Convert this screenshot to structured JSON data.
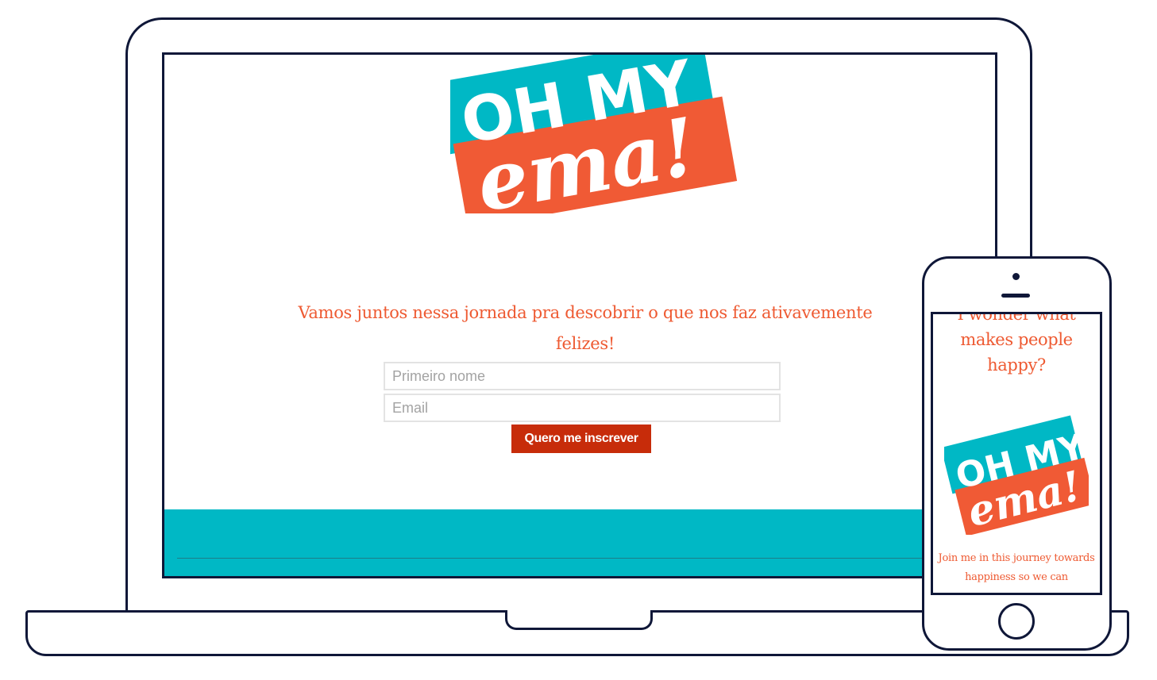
{
  "desktop": {
    "logo": {
      "line1": "OH MY",
      "line2": "ema!"
    },
    "tagline": "Vamos juntos nessa jornada pra descobrir o que nos faz ativavemente felizes!",
    "form": {
      "first_name_placeholder": "Primeiro nome",
      "email_placeholder": "Email",
      "submit_label": "Quero me inscrever"
    }
  },
  "mobile": {
    "heading": "I wonder what makes people happy?",
    "logo": {
      "line1": "OH MY",
      "line2": "ema!"
    },
    "body": "Join me in this journey towards happiness so we can"
  },
  "colors": {
    "teal": "#00b8c5",
    "orange": "#f05a35",
    "button_red": "#c72c0a",
    "outline_navy": "#0f1738"
  }
}
